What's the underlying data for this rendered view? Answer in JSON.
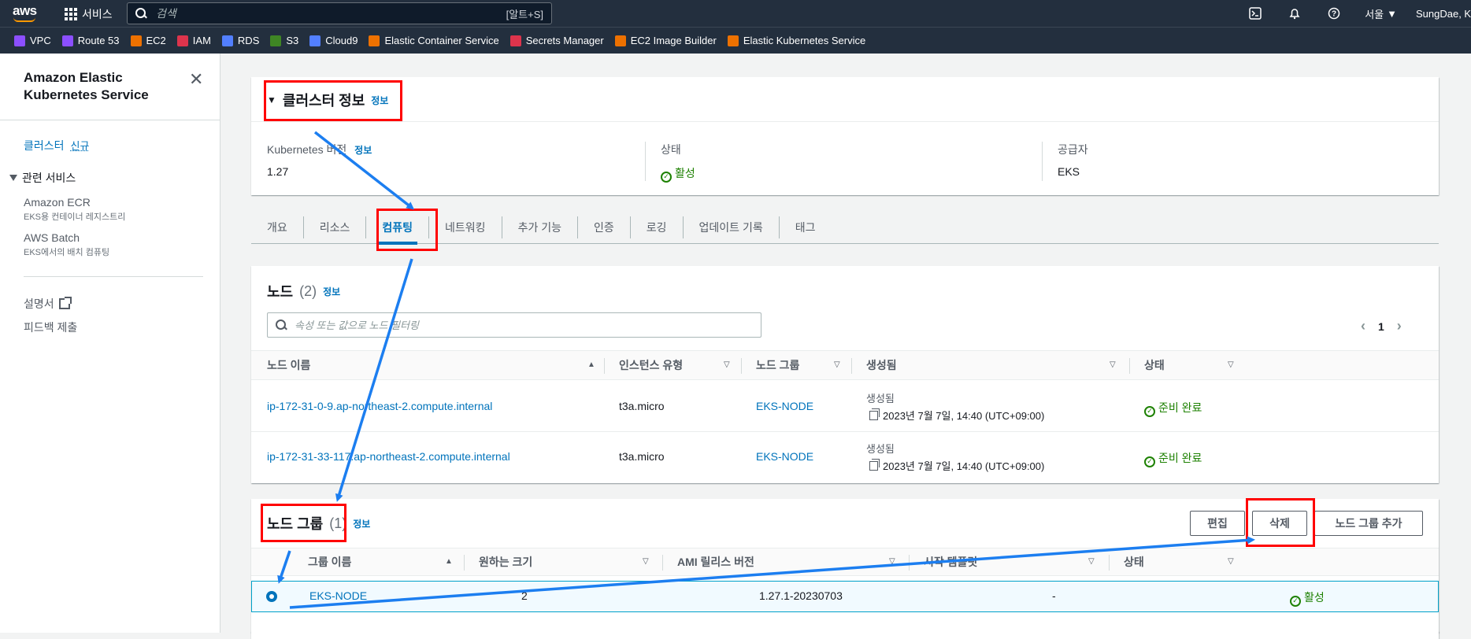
{
  "topbar": {
    "logo": "aws",
    "services_label": "서비스",
    "search_placeholder": "검색",
    "search_shortcut": "[알트+S]",
    "region": "서울",
    "user": "SungDae, Kim",
    "icons": [
      "cloudshell-icon",
      "bell-icon",
      "help-icon"
    ]
  },
  "favorites": [
    {
      "label": "VPC",
      "color": "#8c4fff"
    },
    {
      "label": "Route 53",
      "color": "#8c4fff"
    },
    {
      "label": "EC2",
      "color": "#ed7100"
    },
    {
      "label": "IAM",
      "color": "#dd344c"
    },
    {
      "label": "RDS",
      "color": "#527fff"
    },
    {
      "label": "S3",
      "color": "#3f8624"
    },
    {
      "label": "Cloud9",
      "color": "#527fff"
    },
    {
      "label": "Elastic Container Service",
      "color": "#ed7100"
    },
    {
      "label": "Secrets Manager",
      "color": "#dd344c"
    },
    {
      "label": "EC2 Image Builder",
      "color": "#ed7100"
    },
    {
      "label": "Elastic Kubernetes Service",
      "color": "#ed7100"
    }
  ],
  "sidebar": {
    "title": "Amazon Elastic Kubernetes Service",
    "clusters": "클러스터",
    "new_badge": "신규",
    "related": "관련 서비스",
    "items": [
      {
        "name": "Amazon ECR",
        "sub": "EKS용 컨테이너 레지스트리"
      },
      {
        "name": "AWS Batch",
        "sub": "EKS에서의 배치 컴퓨팅"
      }
    ],
    "docs": "설명서",
    "feedback": "피드백 제출"
  },
  "cluster_info": {
    "title": "클러스터 정보",
    "info": "정보",
    "k8s_label": "Kubernetes 버전",
    "k8s_info": "정보",
    "k8s_value": "1.27",
    "status_label": "상태",
    "status_value": "활성",
    "provider_label": "공급자",
    "provider_value": "EKS"
  },
  "tabs": [
    "개요",
    "리소스",
    "컴퓨팅",
    "네트워킹",
    "추가 기능",
    "인증",
    "로깅",
    "업데이트 기록",
    "태그"
  ],
  "nodes": {
    "title": "노드",
    "count": "(2)",
    "info": "정보",
    "filter_placeholder": "속성 또는 값으로 노드 필터링",
    "page": "1",
    "columns": [
      "노드 이름",
      "인스턴스 유형",
      "노드 그룹",
      "생성됨",
      "상태"
    ],
    "rows": [
      {
        "name": "ip-172-31-0-9.ap-northeast-2.compute.internal",
        "type": "t3a.micro",
        "group": "EKS-NODE",
        "created_label": "생성됨",
        "created": "2023년 7월 7일, 14:40 (UTC+09:00)",
        "status": "준비 완료"
      },
      {
        "name": "ip-172-31-33-117.ap-northeast-2.compute.internal",
        "type": "t3a.micro",
        "group": "EKS-NODE",
        "created_label": "생성됨",
        "created": "2023년 7월 7일, 14:40 (UTC+09:00)",
        "status": "준비 완료"
      }
    ]
  },
  "node_groups": {
    "title": "노드 그룹",
    "count": "(1)",
    "info": "정보",
    "edit_btn": "편집",
    "delete_btn": "삭제",
    "add_btn": "노드 그룹 추가",
    "columns": [
      "그룹 이름",
      "원하는 크기",
      "AMI 릴리스 버전",
      "시작 템플릿",
      "상태"
    ],
    "rows": [
      {
        "name": "EKS-NODE",
        "size": "2",
        "ami": "1.27.1-20230703",
        "template": "-",
        "status": "활성"
      }
    ]
  }
}
